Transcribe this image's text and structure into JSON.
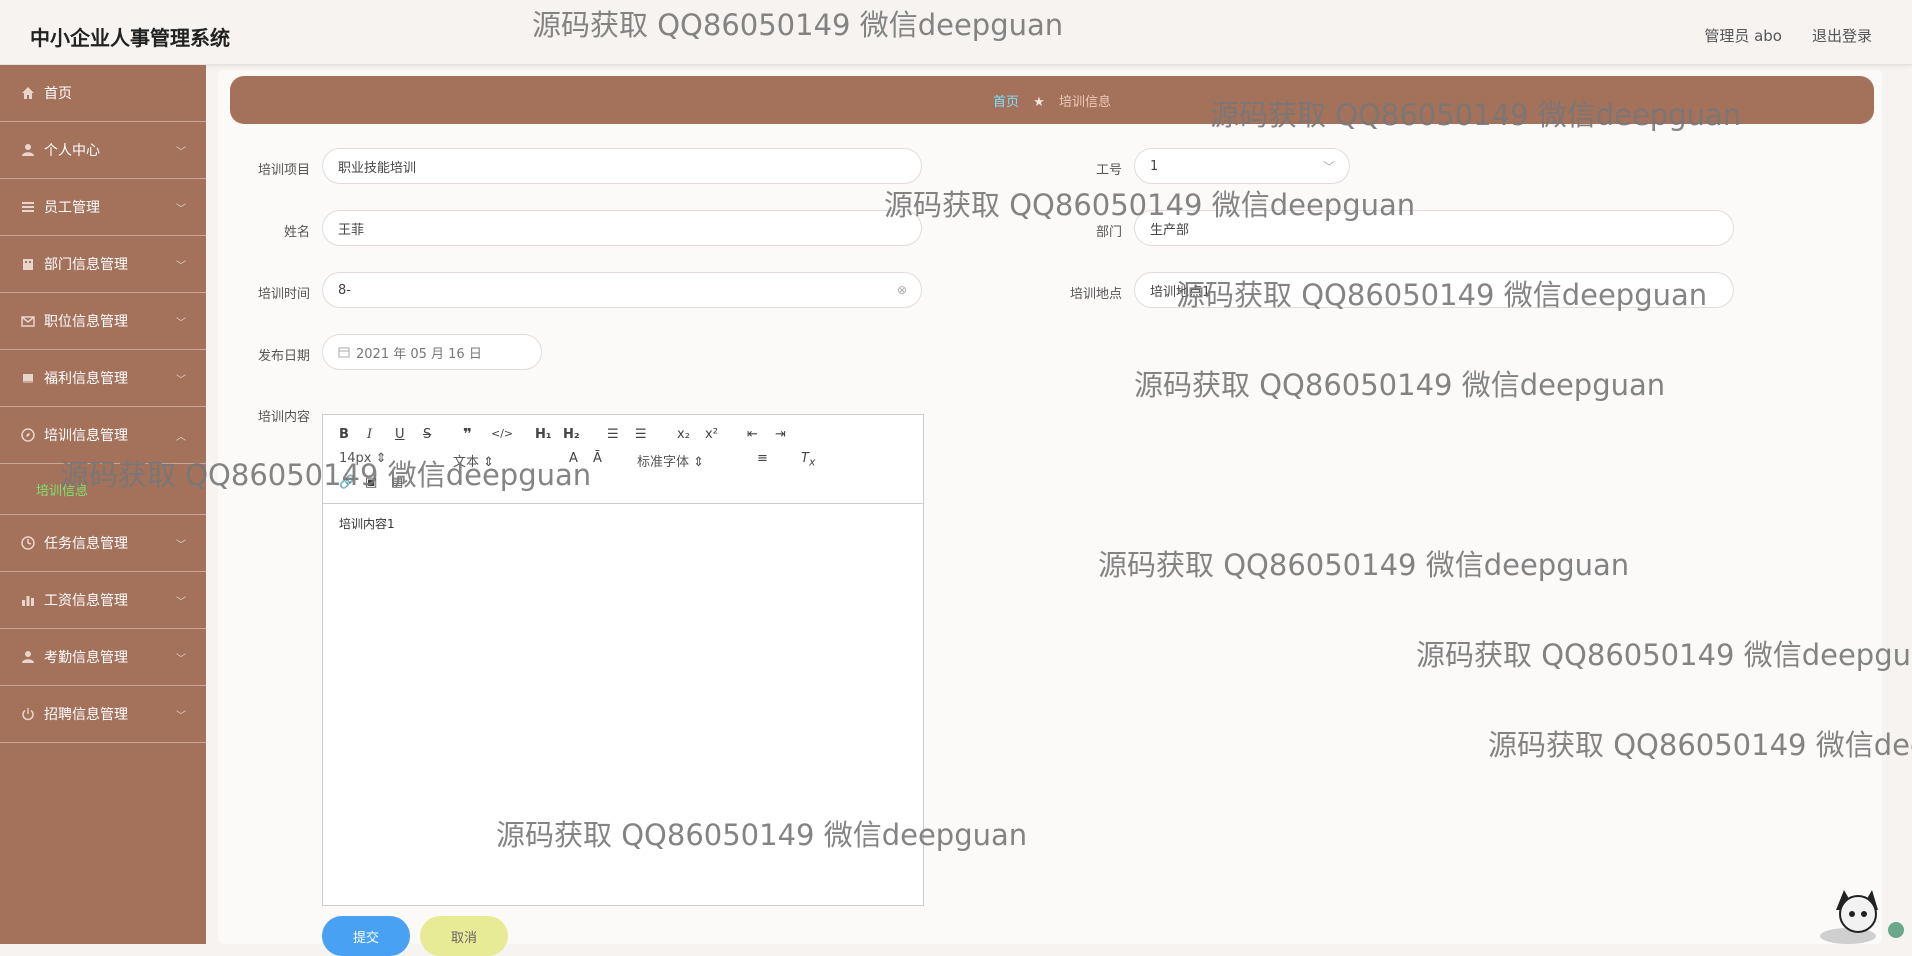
{
  "header": {
    "app_title": "中小企业人事管理系统",
    "user": "管理员 abo",
    "logout": "退出登录"
  },
  "sidebar": {
    "items": [
      {
        "label": "首页",
        "icon": "home-icon",
        "has_chevron": false
      },
      {
        "label": "个人中心",
        "icon": "user-icon",
        "has_chevron": true
      },
      {
        "label": "员工管理",
        "icon": "list-icon",
        "has_chevron": true
      },
      {
        "label": "部门信息管理",
        "icon": "building-icon",
        "has_chevron": true
      },
      {
        "label": "职位信息管理",
        "icon": "mail-icon",
        "has_chevron": true
      },
      {
        "label": "福利信息管理",
        "icon": "gift-icon",
        "has_chevron": true
      },
      {
        "label": "培训信息管理",
        "icon": "compass-icon",
        "has_chevron": true,
        "expanded": true
      },
      {
        "label": "任务信息管理",
        "icon": "clock-icon",
        "has_chevron": true
      },
      {
        "label": "工资信息管理",
        "icon": "bar-chart-icon",
        "has_chevron": true
      },
      {
        "label": "考勤信息管理",
        "icon": "user-icon",
        "has_chevron": true
      },
      {
        "label": "招聘信息管理",
        "icon": "power-icon",
        "has_chevron": true
      }
    ],
    "sub_item": "培训信息"
  },
  "breadcrumb": {
    "home": "首页",
    "current": "培训信息"
  },
  "form": {
    "project_label": "培训项目",
    "project_value": "职业技能培训",
    "empno_label": "工号",
    "empno_value": "1",
    "name_label": "姓名",
    "name_value": "王菲",
    "dept_label": "部门",
    "dept_value": "生产部",
    "time_label": "培训时间",
    "time_value": "8-",
    "place_label": "培训地点",
    "place_value": "培训地点1",
    "date_label": "发布日期",
    "date_value": "2021 年 05 月 16 日",
    "content_label": "培训内容",
    "content_value": "培训内容1",
    "submit": "提交",
    "cancel": "取消"
  },
  "editor_toolbar": {
    "font_size": "14px",
    "text_style": "文本",
    "font_family": "标准字体"
  },
  "watermark_text": "源码获取 QQ86050149 微信deepguan",
  "colors": {
    "sidebar": "#a4715a",
    "submit": "#48a1f3",
    "cancel": "#e8eb95",
    "active_sub": "#7ee36f"
  }
}
